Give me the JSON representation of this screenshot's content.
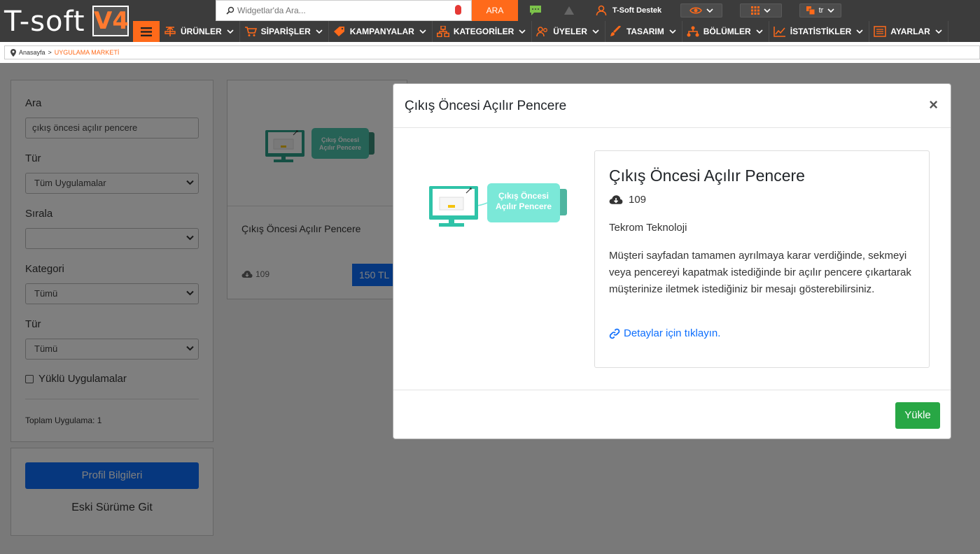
{
  "brand": {
    "logo_text": "T-soft",
    "version": "V4"
  },
  "search": {
    "placeholder": "Widgetlar'da Ara...",
    "button_label": "ARA"
  },
  "user": {
    "name": "T-Soft Destek"
  },
  "language": {
    "selected": "tr"
  },
  "nav": {
    "items": [
      {
        "label": "ÜRÜNLER"
      },
      {
        "label": "SİPARİŞLER"
      },
      {
        "label": "KAMPANYALAR"
      },
      {
        "label": "KATEGORİLER"
      },
      {
        "label": "ÜYELER"
      },
      {
        "label": "TASARIM"
      },
      {
        "label": "BÖLÜMLER"
      },
      {
        "label": "İSTATİSTİKLER"
      },
      {
        "label": "AYARLAR"
      }
    ]
  },
  "breadcrumb": {
    "home": "Anasayfa",
    "separator": ">",
    "current": "UYGULAMA MARKETİ"
  },
  "filter": {
    "search_label": "Ara",
    "search_value": "çıkış öncesi açılır pencere",
    "type_label": "Tür",
    "type_value": "Tüm Uygulamalar",
    "sort_label": "Sırala",
    "sort_value": "",
    "category_label": "Kategori",
    "category_value": "Tümü",
    "type2_label": "Tür",
    "type2_value": "Tümü",
    "installed_label": "Yüklü Uygulamalar",
    "total_label": "Toplam Uygulama: 1"
  },
  "profile": {
    "button_label": "Profil Bilgileri",
    "old_version_label": "Eski Sürüme Git"
  },
  "card": {
    "name": "Çıkış Öncesi Açılır Pencere",
    "downloads": "109",
    "price": "150 TL",
    "thumb_text_1": "Çıkış Öncesi",
    "thumb_text_2": "Açılır Pencere"
  },
  "modal": {
    "title": "Çıkış Öncesi Açılır Pencere",
    "close": "×",
    "app_title": "Çıkış Öncesi Açılır Pencere",
    "downloads": "109",
    "vendor": "Tekrom Teknoloji",
    "description": "Müşteri sayfadan tamamen ayrılmaya karar verdiğinde, sekmeyi veya pencereyi kapatmak istediğinde bir açılır pencere çıkartarak müşterinize iletmek istediğiniz bir mesajı gösterebilirsiniz.",
    "details_link": "Detaylar için tıklayın.",
    "install_button": "Yükle",
    "image_text_1": "Çıkış Öncesi",
    "image_text_2": "Açılır Pencere"
  },
  "colors": {
    "accent": "#ff6a1a",
    "primary": "#0d6efd",
    "success": "#28a745",
    "teal": "#6fe0d4",
    "topbar": "#3c3c3c"
  }
}
